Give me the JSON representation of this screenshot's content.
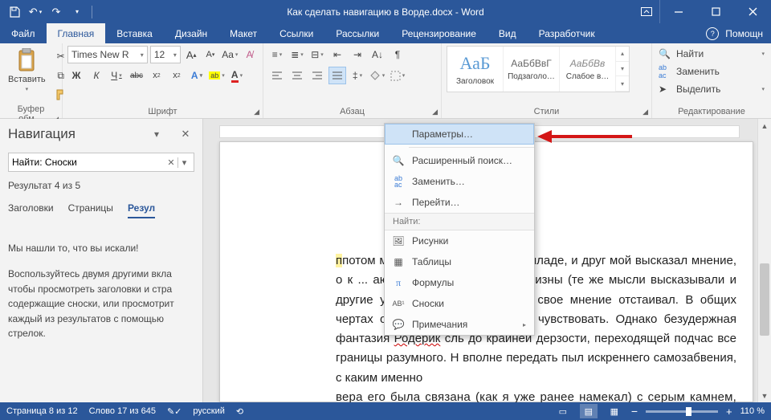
{
  "title": "Как сделать навигацию в Ворде.docx - Word",
  "tabs": {
    "file": "Файл",
    "home": "Главная",
    "insert": "Вставка",
    "design": "Дизайн",
    "layout": "Макет",
    "references": "Ссылки",
    "mailings": "Рассылки",
    "review": "Рецензирование",
    "view": "Вид",
    "developer": "Разработчик",
    "tellme": "Помощн"
  },
  "groups": {
    "clipboard": {
      "label": "Буфер обм…",
      "paste": "Вставить"
    },
    "font": {
      "label": "Шрифт",
      "name": "Times New R",
      "size": "12",
      "bold": "Ж",
      "italic": "К",
      "underline": "Ч",
      "strike": "abc",
      "aa": "Aa"
    },
    "paragraph": {
      "label": "Абзац"
    },
    "styles": {
      "label": "Стили",
      "big": "АаБ",
      "sample": "АаБбВвГ",
      "sample_italic": "АаБбВв",
      "s1": "Заголовок",
      "s2": "Подзаголо…",
      "s3": "Слабое в…"
    },
    "editing": {
      "label": "Редактирование",
      "find": "Найти",
      "replace": "Заменить",
      "select": "Выделить"
    }
  },
  "nav": {
    "title": "Навигация",
    "search_value": "Найти: Сноски",
    "result": "Результат 4 из 5",
    "tab_headings": "Заголовки",
    "tab_pages": "Страницы",
    "tab_results": "Резул",
    "found": "Мы нашли то, что вы искали!",
    "desc": "Воспользуйтесь двумя другими вкла чтобы просмотреть заголовки и стра содержащие сноски, или просмотрит каждый из результатов с помощью стрелок."
  },
  "menu": {
    "options": "Параметры…",
    "adv_search": "Расширенный поиск…",
    "replace": "Заменить…",
    "goto": "Перейти…",
    "find_header": "Найти:",
    "pictures": "Рисунки",
    "tables": "Таблицы",
    "formulas": "Формулы",
    "footnotes": "Сноски",
    "comments": "Примечания"
  },
  "doc": {
    "text": "потом мы беседовали об этой балладе, и друг мой высказал мнение, о к ... аю не столько ради его новизны (те же мысли высказывали и другие упорства, с каким он это свое мнение отстаивал. В общих чертах оно св астения способны чувствовать. Однако безудержная фантазия ",
    "roderik": "Родерик",
    "text2": " сль до крайней дерзости, переходящей подчас все границы разумного. Н вполне передать пыл искреннего самозабвения, с каким именно ",
    "text3": " вера его была связана (как я уже ранее намекал) с серым камнем, из"
  },
  "status": {
    "page": "Страница 8 из 12",
    "words": "Слово 17 из 645",
    "lang": "русский",
    "zoom": "110 %",
    "track_icon": "⟲"
  }
}
